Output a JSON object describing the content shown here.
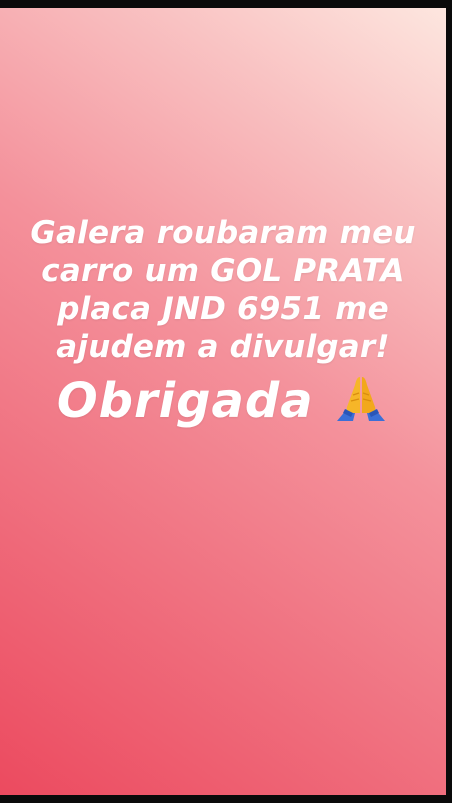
{
  "story": {
    "lines": [
      "Galera roubaram meu",
      "carro um GOL PRATA",
      "placa JND 6951 me",
      "ajudem a divulgar!"
    ],
    "thanks": "Obrigada",
    "emoji_icon": "folded-hands-icon",
    "colors": {
      "gradient_start": "#ec4a5f",
      "gradient_end": "#fde6df",
      "text": "#ffffff"
    }
  }
}
